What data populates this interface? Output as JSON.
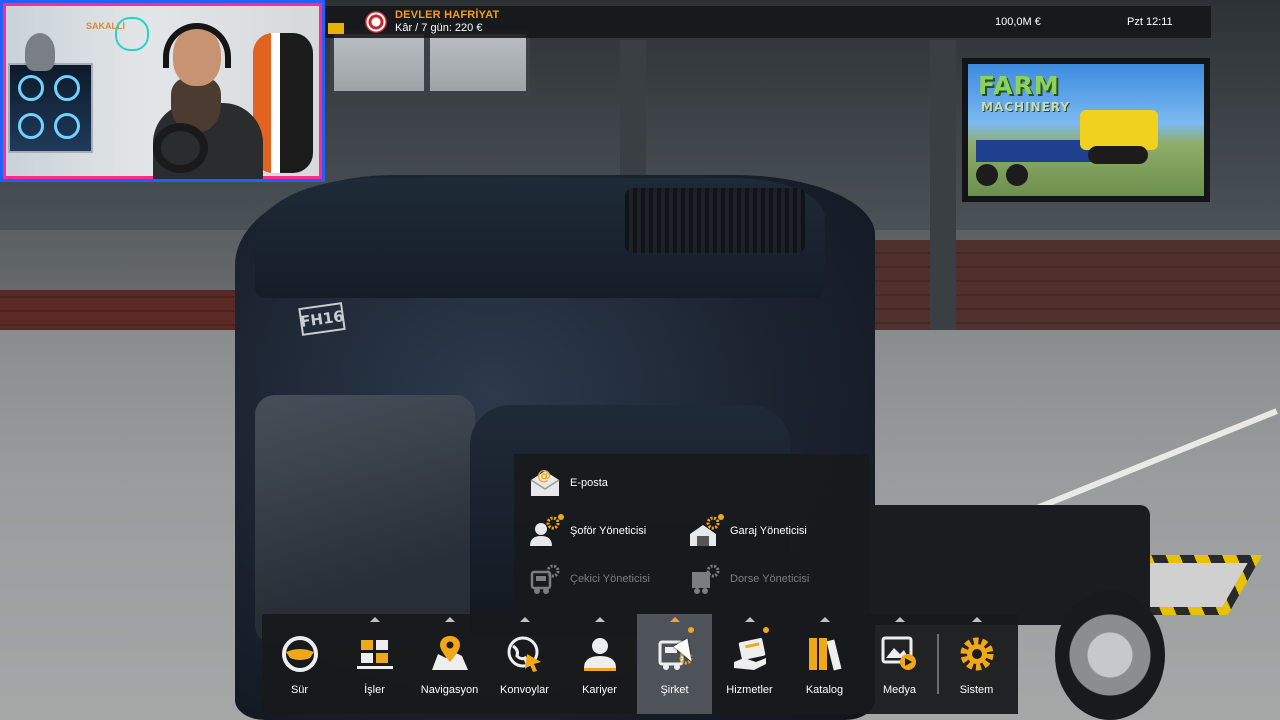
{
  "hud": {
    "company_name": "DEVLER HAFRİYAT",
    "profit_line": "Kâr / 7 gün: 220 €",
    "money": "100,0M  €",
    "clock": "Pzt 12:11"
  },
  "webcam": {
    "logo_text": "SAKALLI"
  },
  "billboard": {
    "title": "FARM",
    "subtitle": "MACHINERY"
  },
  "truck": {
    "badge": "FH16"
  },
  "company_menu": {
    "items": [
      {
        "label": "E-posta",
        "icon": "email-icon",
        "enabled": true
      },
      {
        "label": "Şoför Yöneticisi",
        "icon": "driver-manager-icon",
        "enabled": true
      },
      {
        "label": "Garaj Yöneticisi",
        "icon": "garage-manager-icon",
        "enabled": true
      },
      {
        "label": "Çekici Yöneticisi",
        "icon": "truck-manager-icon",
        "enabled": false
      },
      {
        "label": "Dorse Yöneticisi",
        "icon": "trailer-manager-icon",
        "enabled": false
      }
    ]
  },
  "bottom_bar": {
    "items": [
      {
        "label": "Sür",
        "icon": "steering-wheel-icon"
      },
      {
        "label": "İşler",
        "icon": "jobs-icon"
      },
      {
        "label": "Navigasyon",
        "icon": "map-pin-icon"
      },
      {
        "label": "Konvoylar",
        "icon": "globe-icon"
      },
      {
        "label": "Kariyer",
        "icon": "person-icon"
      },
      {
        "label": "Şirket",
        "icon": "company-icon",
        "active": true
      },
      {
        "label": "Hizmetler",
        "icon": "services-icon"
      },
      {
        "label": "Katalog",
        "icon": "books-icon"
      },
      {
        "label": "Medya",
        "icon": "media-icon"
      },
      {
        "label": "Sistem",
        "icon": "gear-icon"
      }
    ]
  },
  "colors": {
    "accent": "#f0a818",
    "company_name": "#f0a020",
    "panel_bg": "#18191b",
    "active_tab": "#4d5358"
  }
}
